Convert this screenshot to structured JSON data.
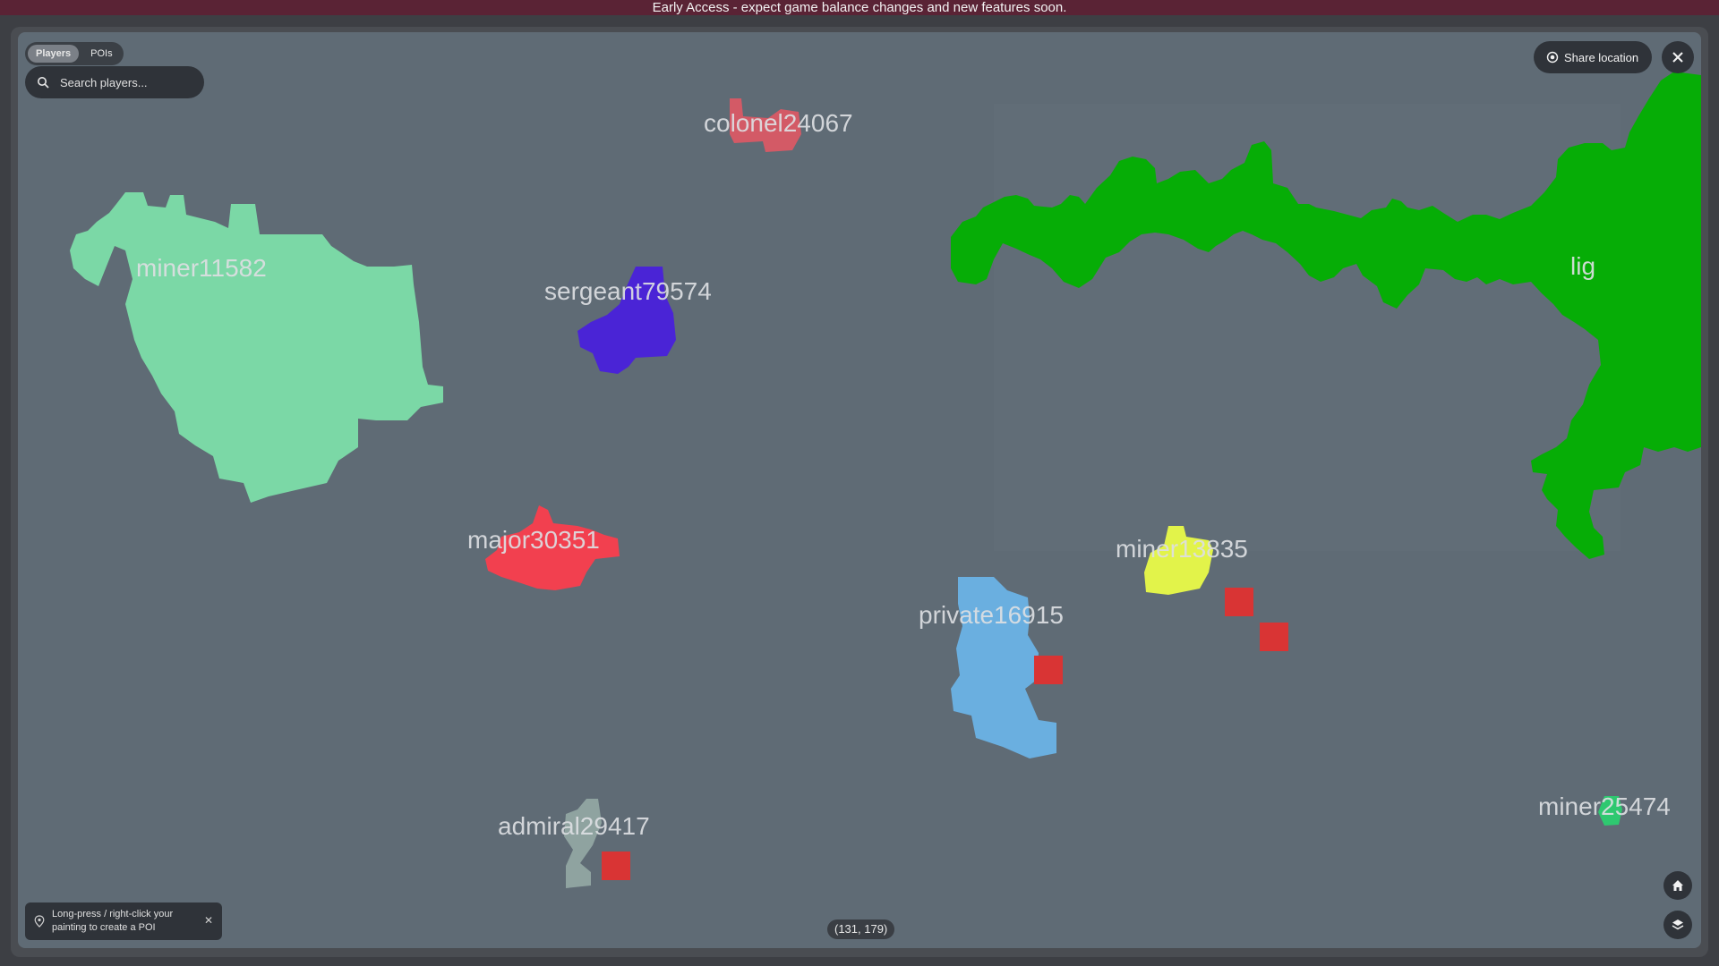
{
  "banner": "Early Access - expect game balance changes and new features soon.",
  "tabs": [
    "Players",
    "POIs"
  ],
  "search": {
    "placeholder": "Search players..."
  },
  "share_label": "Share location",
  "players": [
    "colonel24067",
    "miner11582",
    "sergeant79574",
    "lig",
    "major30351",
    "miner13835",
    "private16915",
    "admiral29417",
    "miner25474"
  ],
  "hint": "Long-press / right-click your painting to create a POI",
  "coords": "(131, 179)",
  "colors": {
    "map_bg": "#5f6b75",
    "miner11582": "#7bd8a6",
    "sergeant79574": "#4a24d6",
    "lig": "#06ad06",
    "major30351": "#f2404f",
    "miner13835": "#e2f34a",
    "private16915": "#6aafe0",
    "admiral29417": "#8fa3a0",
    "colonel24067": "#d35a66",
    "miner25474": "#2ec870",
    "marker": "#d93434"
  }
}
